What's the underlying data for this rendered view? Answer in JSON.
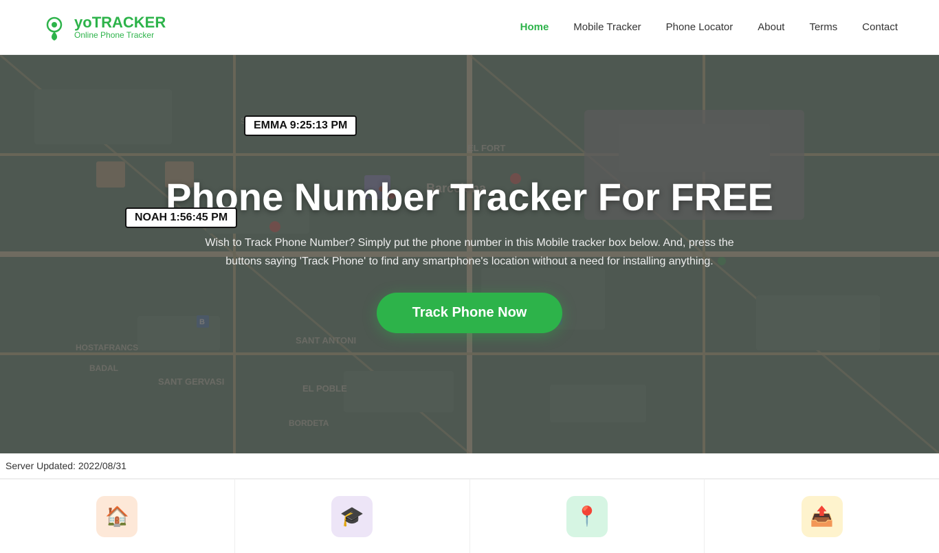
{
  "header": {
    "logo_title_yo": "yo",
    "logo_title_tracker": "TRACKER",
    "logo_subtitle": "Online Phone Tracker",
    "nav": [
      {
        "label": "Home",
        "active": true,
        "id": "nav-home"
      },
      {
        "label": "Mobile Tracker",
        "active": false,
        "id": "nav-mobile-tracker"
      },
      {
        "label": "Phone Locator",
        "active": false,
        "id": "nav-phone-locator"
      },
      {
        "label": "About",
        "active": false,
        "id": "nav-about"
      },
      {
        "label": "Terms",
        "active": false,
        "id": "nav-terms"
      },
      {
        "label": "Contact",
        "active": false,
        "id": "nav-contact"
      }
    ]
  },
  "hero": {
    "title": "Phone Number Tracker For FREE",
    "description": "Wish to Track Phone Number? Simply put the phone number in this Mobile tracker box below. And, press the buttons saying 'Track Phone' to find any smartphone's location without a need for installing anything.",
    "cta_label": "Track Phone Now",
    "map_label1": "EMMA  9:25:13 PM",
    "map_label2": "NOAH  1:56:45 PM"
  },
  "server_update": "Server Updated: 2022/08/31",
  "features": [
    {
      "icon": "🏠",
      "color_class": "icon-orange"
    },
    {
      "icon": "🎓",
      "color_class": "icon-purple"
    },
    {
      "icon": "📍",
      "color_class": "icon-green"
    },
    {
      "icon": "📤",
      "color_class": "icon-yellow"
    }
  ]
}
